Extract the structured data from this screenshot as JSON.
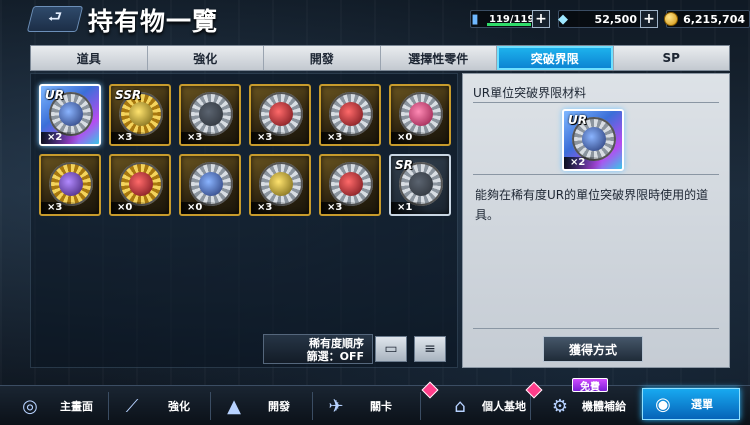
{
  "header": {
    "back_icon": "back-arrow-icon",
    "title": "持有物一覽",
    "ap": "119/119",
    "gems": "52,500",
    "coins": "6,215,704"
  },
  "tabs": [
    {
      "label": "道具",
      "active": false
    },
    {
      "label": "強化",
      "active": false
    },
    {
      "label": "開發",
      "active": false
    },
    {
      "label": "選擇性零件",
      "active": false
    },
    {
      "label": "突破界限",
      "active": true
    },
    {
      "label": "SP",
      "active": false
    }
  ],
  "items": [
    {
      "rank": "UR",
      "qty": "×2",
      "style": "ur",
      "gear": "silver",
      "core": "blue"
    },
    {
      "rank": "SSR",
      "qty": "×3",
      "style": "normal",
      "gear": "gold",
      "core": "yellow"
    },
    {
      "rank": "",
      "qty": "×3",
      "style": "normal",
      "gear": "silver",
      "core": "dark"
    },
    {
      "rank": "",
      "qty": "×3",
      "style": "normal",
      "gear": "silver",
      "core": "red"
    },
    {
      "rank": "",
      "qty": "×3",
      "style": "normal",
      "gear": "silver",
      "core": "red"
    },
    {
      "rank": "",
      "qty": "×0",
      "style": "normal",
      "gear": "silver",
      "core": "pink"
    },
    {
      "rank": "",
      "qty": "×3",
      "style": "normal",
      "gear": "gold",
      "core": "purple"
    },
    {
      "rank": "",
      "qty": "×0",
      "style": "normal",
      "gear": "gold",
      "core": "red"
    },
    {
      "rank": "",
      "qty": "×0",
      "style": "normal",
      "gear": "silver",
      "core": "blue"
    },
    {
      "rank": "",
      "qty": "×3",
      "style": "normal",
      "gear": "silver",
      "core": "yellow"
    },
    {
      "rank": "",
      "qty": "×3",
      "style": "normal",
      "gear": "silver",
      "core": "red"
    },
    {
      "rank": "SR",
      "qty": "×1",
      "style": "sr",
      "gear": "silver",
      "core": "dark"
    }
  ],
  "sort": {
    "line1": "稀有度順序",
    "line2": "篩選：OFF"
  },
  "detail": {
    "title": "UR單位突破界限材料",
    "item_rank": "UR",
    "item_qty": "×2",
    "description": "能夠在稀有度UR的單位突破界限時使用的道具。",
    "obtain_button": "獲得方式"
  },
  "bottom_nav": [
    {
      "label": "主畫面",
      "icon": "home-icon"
    },
    {
      "label": "強化",
      "icon": "upgrade-icon"
    },
    {
      "label": "開發",
      "icon": "develop-icon"
    },
    {
      "label": "關卡",
      "icon": "stage-icon"
    },
    {
      "label": "個人基地",
      "icon": "base-icon"
    },
    {
      "label": "機體補給",
      "icon": "supply-icon"
    },
    {
      "label": "選單",
      "icon": "menu-icon"
    }
  ],
  "free_badge": "免費"
}
